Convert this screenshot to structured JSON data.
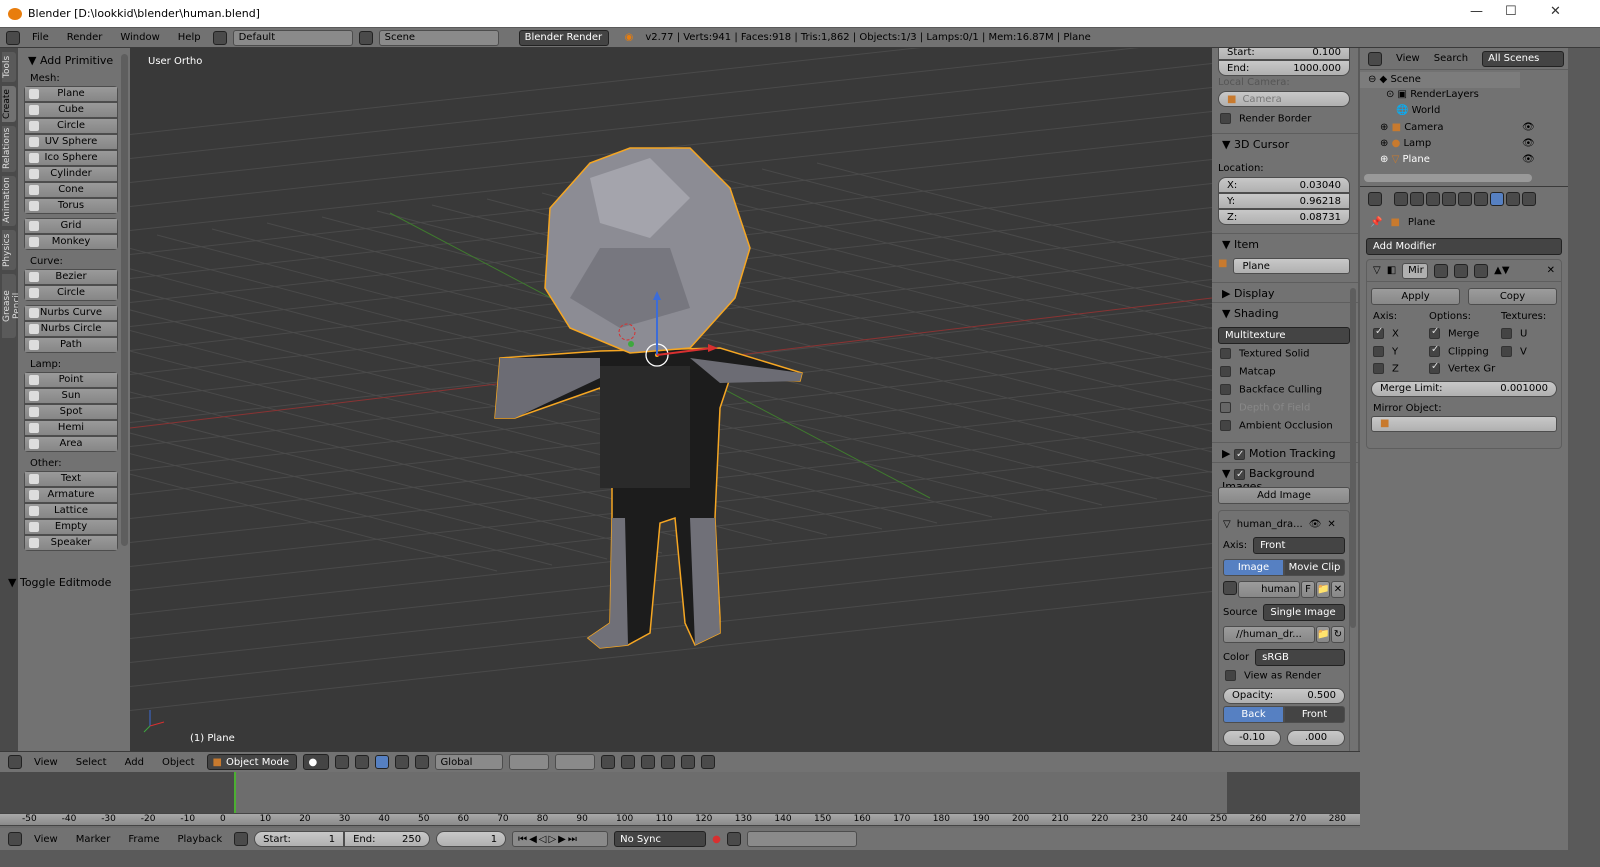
{
  "window": {
    "title": "Blender [D:\\lookkid\\blender\\human.blend]",
    "minimize": "—",
    "maximize": "☐",
    "close": "✕"
  },
  "topbar": {
    "menus": [
      "File",
      "Render",
      "Window",
      "Help"
    ],
    "layout": "Default",
    "scene": "Scene",
    "engine": "Blender Render",
    "stats": "v2.77 | Verts:941 | Faces:918 | Tris:1,862 | Objects:1/3 | Lamps:0/1 | Mem:16.87M | Plane"
  },
  "tool_tabs": [
    "Tools",
    "Create",
    "Relations",
    "Animation",
    "Physics",
    "Grease Pencil"
  ],
  "toolpanel": {
    "title": "Add Primitive",
    "mesh_label": "Mesh:",
    "mesh": [
      "Plane",
      "Cube",
      "Circle",
      "UV Sphere",
      "Ico Sphere",
      "Cylinder",
      "Cone",
      "Torus"
    ],
    "mesh2": [
      "Grid",
      "Monkey"
    ],
    "curve_label": "Curve:",
    "curve": [
      "Bezier",
      "Circle"
    ],
    "curve2": [
      "Nurbs Curve",
      "Nurbs Circle",
      "Path"
    ],
    "lamp_label": "Lamp:",
    "lamp": [
      "Point",
      "Sun",
      "Spot",
      "Hemi",
      "Area"
    ],
    "other_label": "Other:",
    "other": [
      "Text",
      "Armature",
      "Lattice",
      "Empty",
      "Speaker"
    ],
    "toggle": "Toggle Editmode"
  },
  "viewport": {
    "view_name": "User Ortho",
    "object_label": "(1) Plane"
  },
  "npanel": {
    "start_label": "Start:",
    "start": "0.100",
    "end_label": "End:",
    "end": "1000.000",
    "local_camera": "Local Camera:",
    "camera": "Camera",
    "render_border": "Render Border",
    "cursor_title": "3D Cursor",
    "location": "Location:",
    "x_label": "X:",
    "x": "0.03040",
    "y_label": "Y:",
    "y": "0.96218",
    "z_label": "Z:",
    "z": "0.08731",
    "item_title": "Item",
    "item_name": "Plane",
    "display": "Display",
    "shading": "Shading",
    "shading_mode": "Multitexture",
    "textured_solid": "Textured Solid",
    "matcap": "Matcap",
    "backface": "Backface Culling",
    "dof": "Depth Of Field",
    "ao": "Ambient Occlusion",
    "motion_tracking": "Motion Tracking",
    "bg_images": "Background Images",
    "add_image": "Add Image",
    "bg_name": "human_dra...",
    "axis_label": "Axis:",
    "axis": "Front",
    "tab_image": "Image",
    "tab_movie": "Movie Clip",
    "img_name": "human",
    "img_f": "F",
    "source_label": "Source",
    "source": "Single Image",
    "path": "//human_dr...",
    "color_label": "Color",
    "color": "sRGB",
    "view_as_render": "View as Render",
    "opacity_label": "Opacity:",
    "opacity": "0.500",
    "back": "Back",
    "front": "Front",
    "off_x": "-0.10",
    "off_y": ".000"
  },
  "outliner": {
    "view": "View",
    "search": "Search",
    "filter": "All Scenes",
    "items": [
      "Scene",
      "RenderLayers",
      "World",
      "Camera",
      "Lamp",
      "Plane"
    ]
  },
  "properties": {
    "breadcrumb": "Plane",
    "add_modifier": "Add Modifier",
    "modifier_name": "Mir",
    "apply": "Apply",
    "copy": "Copy",
    "axis": "Axis:",
    "options": "Options:",
    "textures": "Textures:",
    "x": "X",
    "y": "Y",
    "z": "Z",
    "merge": "Merge",
    "clipping": "Clipping",
    "vertex_gr": "Vertex Gr",
    "u": "U",
    "v": "V",
    "merge_limit_label": "Merge Limit:",
    "merge_limit": "0.001000",
    "mirror_object": "Mirror Object:"
  },
  "view_header": {
    "menus": [
      "View",
      "Select",
      "Add",
      "Object"
    ],
    "mode": "Object Mode",
    "orientation": "Global"
  },
  "timeline": {
    "ticks": [
      "-50",
      "-40",
      "-30",
      "-20",
      "-10",
      "0",
      "10",
      "20",
      "30",
      "40",
      "50",
      "60",
      "70",
      "80",
      "90",
      "100",
      "110",
      "120",
      "130",
      "140",
      "150",
      "160",
      "170",
      "180",
      "190",
      "200",
      "210",
      "220",
      "230",
      "240",
      "250",
      "260",
      "270",
      "280"
    ],
    "current_frame": "1",
    "menus": [
      "View",
      "Marker",
      "Frame",
      "Playback"
    ],
    "start_label": "Start:",
    "start": "1",
    "end_label": "End:",
    "end": "250",
    "frame": "1",
    "sync": "No Sync"
  },
  "colors": {
    "accent": "#5680c2",
    "selection": "#f5a623",
    "frame": "#4caf32"
  }
}
